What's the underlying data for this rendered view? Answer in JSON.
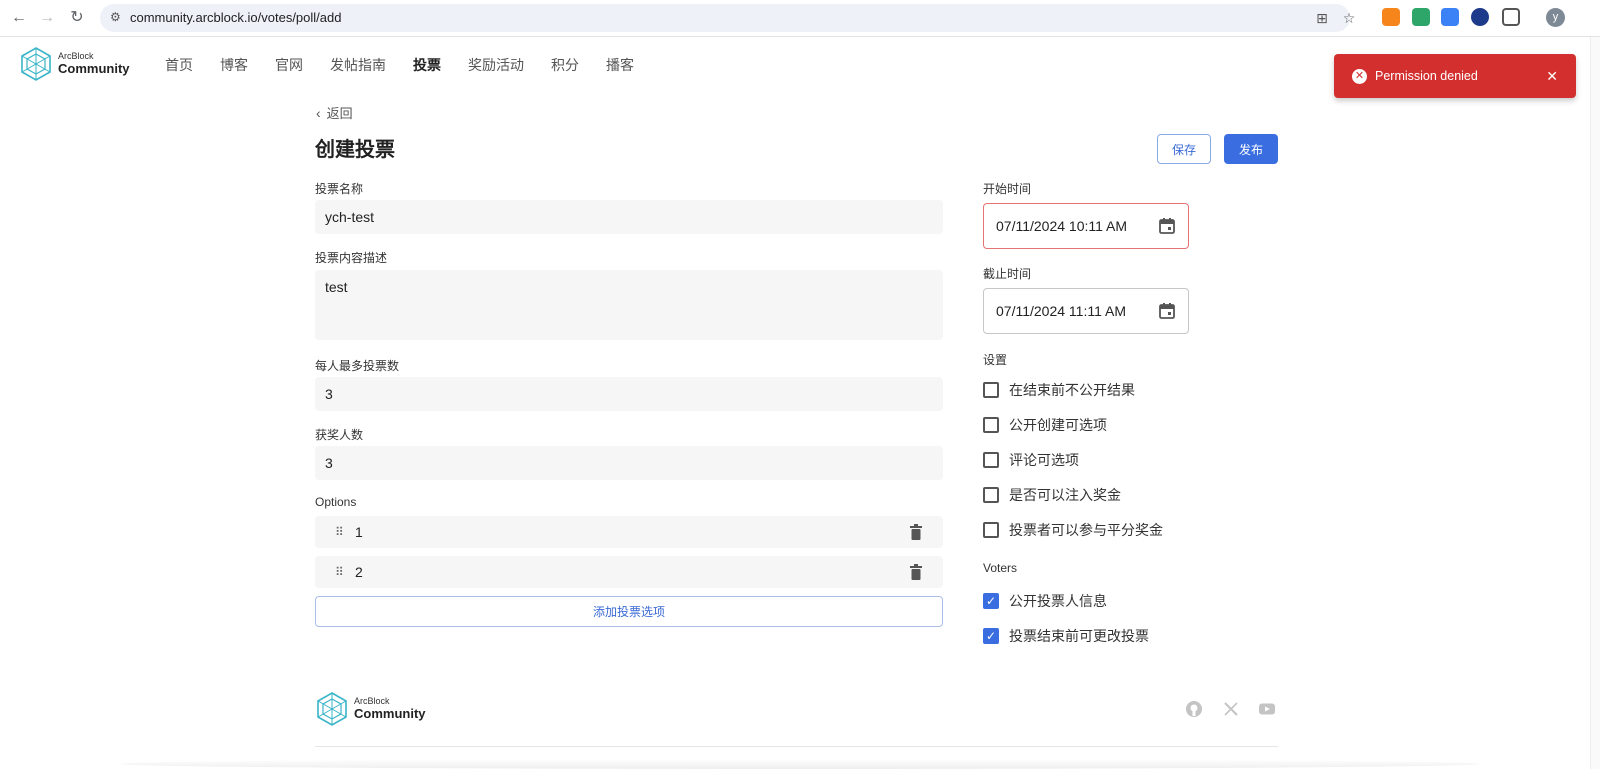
{
  "browser": {
    "url": "community.arcblock.io/votes/poll/add",
    "avatar_initial": "y"
  },
  "site": {
    "logo_small": "ArcBlock",
    "logo_big": "Community",
    "nav": [
      "首页",
      "博客",
      "官网",
      "发帖指南",
      "投票",
      "奖励活动",
      "积分",
      "播客"
    ],
    "active_nav": "投票"
  },
  "toast": {
    "message": "Permission denied",
    "close": "✕"
  },
  "page": {
    "back_label": "返回",
    "title": "创建投票",
    "save_label": "保存",
    "publish_label": "发布"
  },
  "form": {
    "name_label": "投票名称",
    "name_value": "ych-test",
    "desc_label": "投票内容描述",
    "desc_value": "test",
    "max_votes_label": "每人最多投票数",
    "max_votes_value": "3",
    "winners_label": "获奖人数",
    "winners_value": "3",
    "options_label": "Options",
    "options": [
      "1",
      "2"
    ],
    "add_option_label": "添加投票选项",
    "start_label": "开始时间",
    "start_value": "07/11/2024 10:11 AM",
    "end_label": "截止时间",
    "end_value": "07/11/2024 11:11 AM",
    "settings_label": "设置",
    "settings": [
      {
        "label": "在结束前不公开结果",
        "checked": false
      },
      {
        "label": "公开创建可选项",
        "checked": false
      },
      {
        "label": "评论可选项",
        "checked": false
      },
      {
        "label": "是否可以注入奖金",
        "checked": false
      },
      {
        "label": "投票者可以参与平分奖金",
        "checked": false
      }
    ],
    "voters_label": "Voters",
    "voters": [
      {
        "label": "公开投票人信息",
        "checked": true
      },
      {
        "label": "投票结束前可更改投票",
        "checked": true
      }
    ]
  },
  "footer": {
    "logo_small": "ArcBlock",
    "logo_big": "Community",
    "social_icons": [
      "github-icon",
      "x-icon",
      "youtube-icon"
    ]
  },
  "colors": {
    "primary": "#3a6ee0",
    "toast_error": "#d32f2f",
    "logo": "#3ab4c8"
  }
}
